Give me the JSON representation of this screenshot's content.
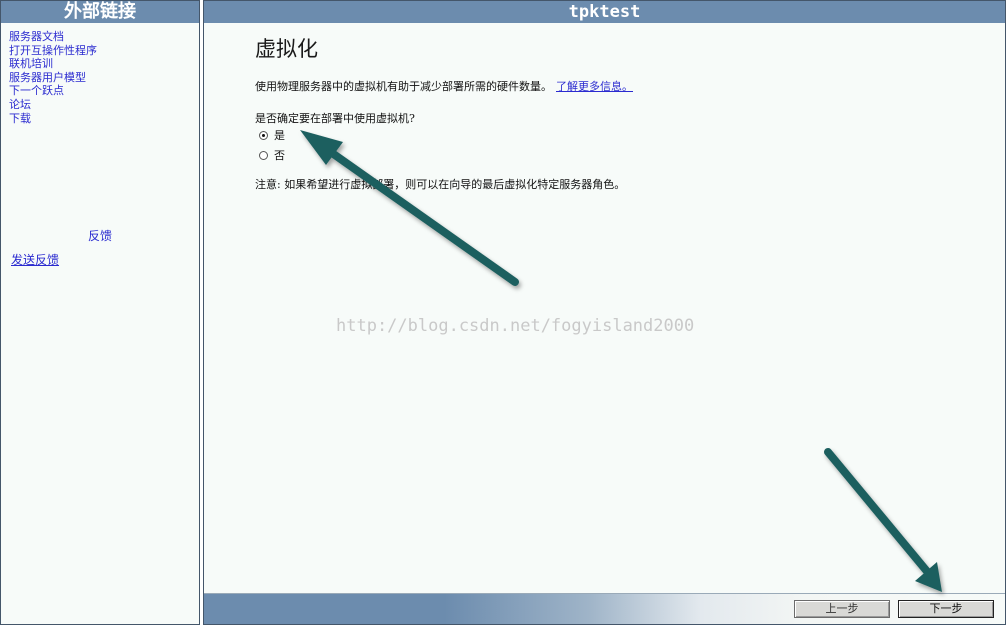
{
  "sidebar": {
    "title": "外部链接",
    "links": [
      "服务器文档",
      "打开互操作性程序",
      "联机培训",
      "服务器用户模型",
      "下一个跃点",
      "论坛",
      "下载"
    ],
    "feedback_heading": "反馈",
    "send_feedback_label": "发送反馈"
  },
  "main": {
    "header_title": "tpktest",
    "page_title": "虚拟化",
    "description": "使用物理服务器中的虚拟机有助于减少部署所需的硬件数量。",
    "learn_more_label": "了解更多信息。",
    "question": "是否确定要在部署中使用虚拟机?",
    "options": [
      {
        "label": "是",
        "selected": true
      },
      {
        "label": "否",
        "selected": false
      }
    ],
    "note": "注意: 如果希望进行虚拟部署，则可以在向导的最后虚拟化特定服务器角色。",
    "watermark": "http://blog.csdn.net/fogyisland2000"
  },
  "footer": {
    "prev_label": "上一步",
    "next_label": "下一步"
  },
  "colors": {
    "header_bar": "#6c8cae",
    "link": "#2b2bd0",
    "panel_background": "#f7fbf9",
    "annotation_arrow": "#1f5f5f"
  }
}
